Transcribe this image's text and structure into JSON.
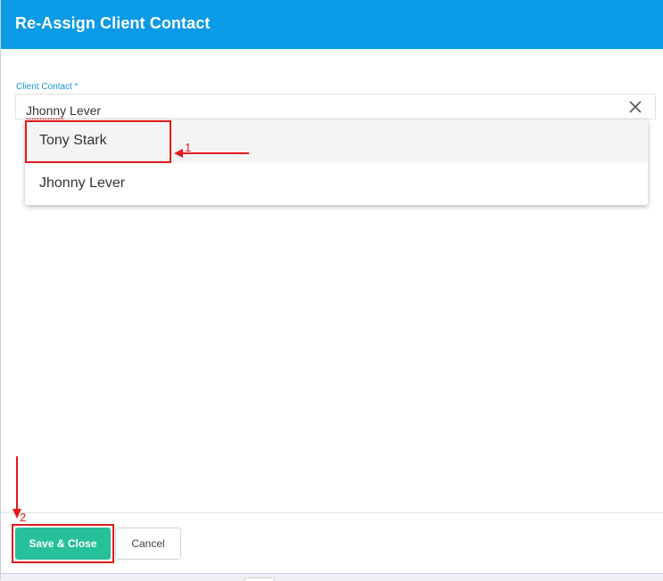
{
  "dialog": {
    "title": "Re-Assign Client Contact",
    "header_color": "#0b9ae5"
  },
  "field": {
    "label": "Client Contact *",
    "value": "Jhonny Lever",
    "clear_icon": "close-icon"
  },
  "dropdown": {
    "options": [
      {
        "label": "Tony Stark",
        "highlighted": true
      },
      {
        "label": "Jhonny Lever",
        "highlighted": false
      }
    ]
  },
  "annotations": {
    "step1": "1",
    "step2": "2",
    "color": "#e11a1a"
  },
  "footer": {
    "save_label": "Save & Close",
    "cancel_label": "Cancel",
    "save_color": "#26c09a"
  }
}
